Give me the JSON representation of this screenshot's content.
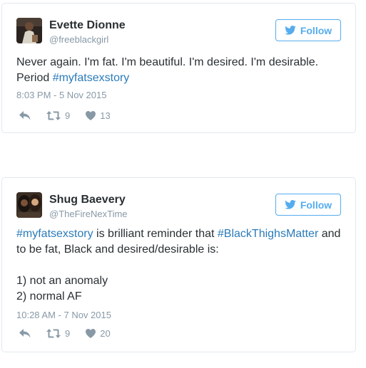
{
  "colors": {
    "accent": "#55acee",
    "link": "#2b7bb9",
    "muted": "#8899a6",
    "text": "#292f33",
    "border": "#e1e8ed"
  },
  "tweets": [
    {
      "name": "Evette Dionne",
      "handle": "@freeblackgirl",
      "follow_label": "Follow",
      "text_parts": [
        "Never again. I'm fat. I'm beautiful. I'm desired. I'm desirable. Period ",
        "#myfatsexstory"
      ],
      "timestamp": "8:03 PM - 5 Nov 2015",
      "retweets": "9",
      "likes": "13",
      "icons": [
        "reply-icon",
        "retweet-icon",
        "heart-icon"
      ]
    },
    {
      "name": "Shug Baevery",
      "handle": "@TheFireNexTime",
      "follow_label": "Follow",
      "text_parts": [
        "#myfatsexstory",
        " is brilliant reminder that ",
        "#BlackThighsMatter",
        " and to be fat, Black and desired/desirable is:\n\n1) not an anomaly\n2) normal AF"
      ],
      "timestamp": "10:28 AM - 7 Nov 2015",
      "retweets": "9",
      "likes": "20",
      "icons": [
        "reply-icon",
        "retweet-icon",
        "heart-icon"
      ]
    }
  ]
}
